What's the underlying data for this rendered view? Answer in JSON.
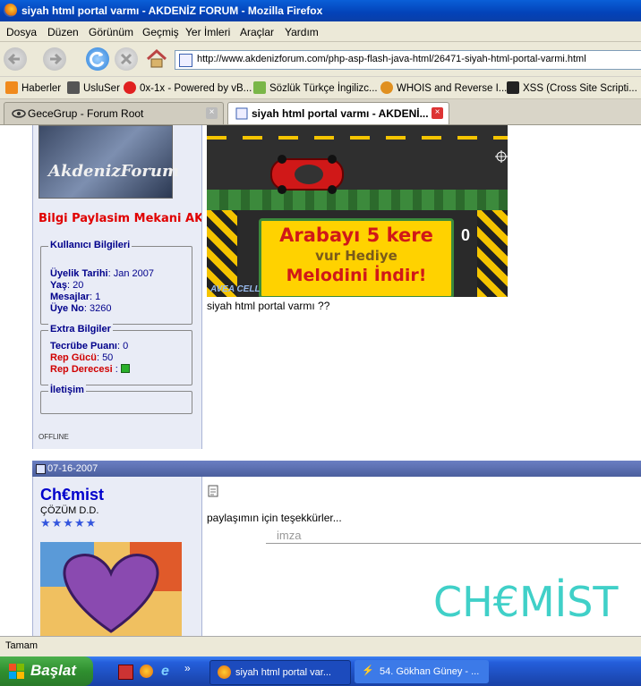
{
  "window": {
    "title": "siyah html portal varmı - AKDENİZ FORUM - Mozilla Firefox"
  },
  "menu": [
    "Dosya",
    "Düzen",
    "Görünüm",
    "Geçmiş",
    "Yer İmleri",
    "Araçlar",
    "Yardım"
  ],
  "address": {
    "url": "http://www.akdenizforum.com/php-asp-flash-java-html/26471-siyah-html-portal-varmi.html"
  },
  "bookmarks": [
    {
      "label": "Haberler",
      "icon": "rss-icon"
    },
    {
      "label": "UsluSer",
      "icon": "user-icon"
    },
    {
      "label": "0x-1x - Powered by vB...",
      "icon": "star-burst-icon"
    },
    {
      "label": "Sözlük Türkçe İngilizc...",
      "icon": "dictionary-icon"
    },
    {
      "label": "WHOIS and Reverse I...",
      "icon": "whois-icon"
    },
    {
      "label": "XSS (Cross Site Scripti...",
      "icon": "rs-icon"
    }
  ],
  "tabs": [
    {
      "label": "GeceGrup - Forum Root",
      "active": false
    },
    {
      "label": "siyah html portal varmı - AKDENİ...",
      "active": true
    }
  ],
  "post1": {
    "slogan": "Bilgi Paylasim Mekani AK",
    "avatar_text": "AkdenizForum",
    "user_info_title": "Kullanıcı Bilgileri",
    "join_label": "Üyelik Tarihi",
    "join_value": ": Jan 2007",
    "age_label": "Yaş",
    "age_value": ": 20",
    "posts_label": "Mesajlar",
    "posts_value": ": 1",
    "member_no_label": "Üye No",
    "member_no_value": ": 3260",
    "extra_title": "Extra Bilgiler",
    "exp_label": "Tecrübe Puanı",
    "exp_value": ": 0",
    "rep_power_label": "Rep Gücü",
    "rep_power_value": ": 50",
    "rep_level_label": "Rep Derecesi",
    "rep_level_value": ":",
    "contact_title": "İletişim",
    "status": "OFFLINE",
    "banner": {
      "line1": "Arabayı 5 kere",
      "line2": "vur Hediye",
      "line3": "Melodini İndir!",
      "score": "0",
      "brand": "AVEA CELL"
    },
    "text": "siyah html portal varmı ??"
  },
  "post2": {
    "date": "07-16-2007",
    "username": "Ch€mist",
    "rank": "ÇÖZÜM D.D.",
    "stars": "★★★★★",
    "text": "paylaşımın için teşekkürler...",
    "signature_label": "imza",
    "signature": "CH€MİST"
  },
  "statusbar": {
    "text": "Tamam"
  },
  "taskbar": {
    "start": "Başlat",
    "tasks": [
      "siyah html portal var...",
      "54. Gökhan Güney - ..."
    ]
  },
  "colors": {
    "accent": "#0000cc",
    "rep": "#d00000",
    "signature": "#40d0c8"
  }
}
